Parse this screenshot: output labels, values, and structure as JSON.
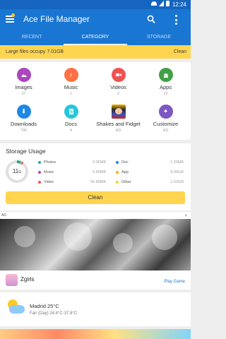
{
  "status_bar": {
    "time": "12:24"
  },
  "app_bar": {
    "title": "Ace File Manager"
  },
  "tabs": [
    {
      "label": "RECENT",
      "active": false
    },
    {
      "label": "CATEGORY",
      "active": true
    },
    {
      "label": "STORAGE",
      "active": false
    }
  ],
  "large_files_banner": {
    "message": "Large files occupy 7.01GB",
    "action": "Clean"
  },
  "categories": [
    {
      "label": "Images",
      "count": "37",
      "icon": "image-icon",
      "color": "#ab47bc"
    },
    {
      "label": "Music",
      "count": "1",
      "icon": "music-icon",
      "color": "#ff7043"
    },
    {
      "label": "Videos",
      "count": "2",
      "icon": "video-icon",
      "color": "#ef5350"
    },
    {
      "label": "Apps",
      "count": "12",
      "icon": "android-icon",
      "color": "#43a047"
    },
    {
      "label": "Downloads",
      "count": "780",
      "icon": "download-icon",
      "color": "#1e88e5"
    },
    {
      "label": "Docs",
      "count": "4",
      "icon": "document-icon",
      "color": "#26c6da"
    },
    {
      "label": "Shakes and Fidget",
      "count": "AD",
      "icon": "game-icon",
      "color": "#3f51b5"
    },
    {
      "label": "Customize",
      "count": "AD",
      "icon": "customize-icon",
      "color": "#7e57c2"
    }
  ],
  "storage_usage": {
    "heading": "Storage Usage",
    "total_value": "11",
    "total_unit": "G",
    "items": [
      {
        "label": "Photos",
        "value": "3.06MB",
        "color": "#26a69a"
      },
      {
        "label": "Doc",
        "value": "1.33MB",
        "color": "#1e88e5"
      },
      {
        "label": "Music",
        "value": "0.99MB",
        "color": "#ab47bc"
      },
      {
        "label": "App",
        "value": "8.06GB",
        "color": "#ffb300"
      },
      {
        "label": "Video",
        "value": "56.89MB",
        "color": "#ef5350"
      },
      {
        "label": "Other",
        "value": "1.03GB",
        "color": "#ffca28"
      }
    ],
    "clean_button": "Clean"
  },
  "ad": {
    "tag": "AD",
    "close": "✕",
    "app_name": "Zgirls",
    "cta": "Play Game"
  },
  "weather": {
    "city_temp": "Madrid 25°C",
    "description": "Fair (Day) 24.4°C-37.8°C"
  }
}
